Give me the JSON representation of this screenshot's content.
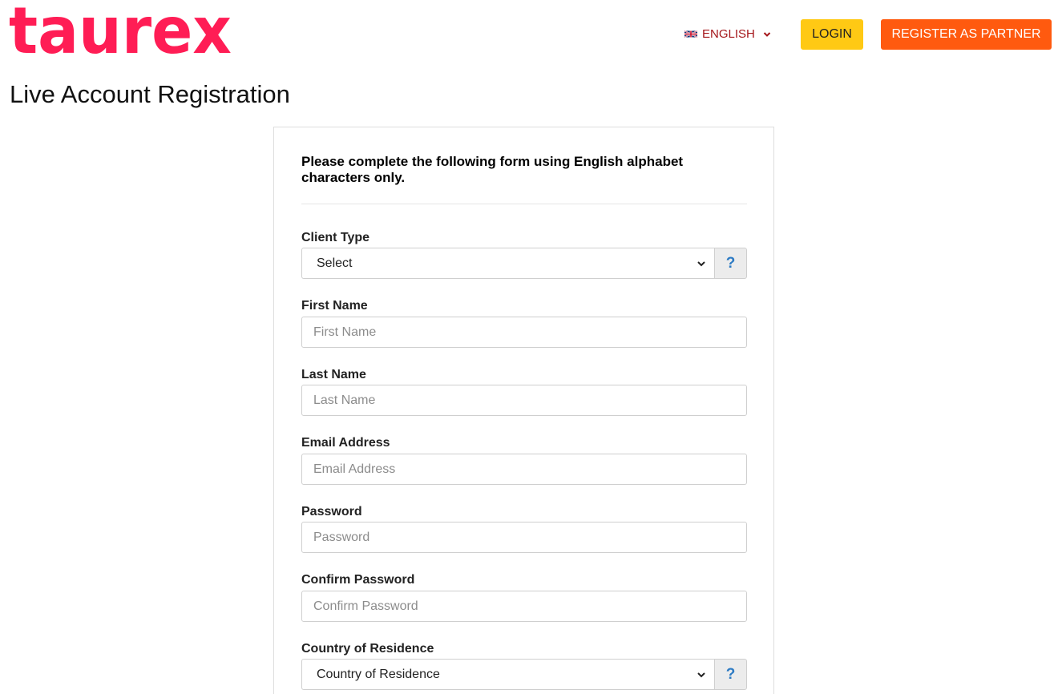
{
  "header": {
    "logo_text": "taurex",
    "language": {
      "label": "ENGLISH",
      "flag_icon": "uk-flag-icon"
    },
    "login_label": "LOGIN",
    "partner_label": "REGISTER AS PARTNER"
  },
  "page": {
    "title": "Live Account Registration"
  },
  "form": {
    "notice": "Please complete the following form using English alphabet characters only.",
    "client_type": {
      "label": "Client Type",
      "value": "Select",
      "help": "?"
    },
    "first_name": {
      "label": "First Name",
      "placeholder": "First Name"
    },
    "last_name": {
      "label": "Last Name",
      "placeholder": "Last Name"
    },
    "email": {
      "label": "Email Address",
      "placeholder": "Email Address"
    },
    "password": {
      "label": "Password",
      "placeholder": "Password"
    },
    "confirm_password": {
      "label": "Confirm Password",
      "placeholder": "Confirm Password"
    },
    "country": {
      "label": "Country of Residence",
      "value": "Country of Residence",
      "help": "?"
    }
  },
  "colors": {
    "brand": "#ff1d55",
    "login_bg": "#ffc914",
    "partner_bg": "#ff5a0f",
    "language_text": "#a4161a",
    "help_icon": "#2d7bc4"
  }
}
